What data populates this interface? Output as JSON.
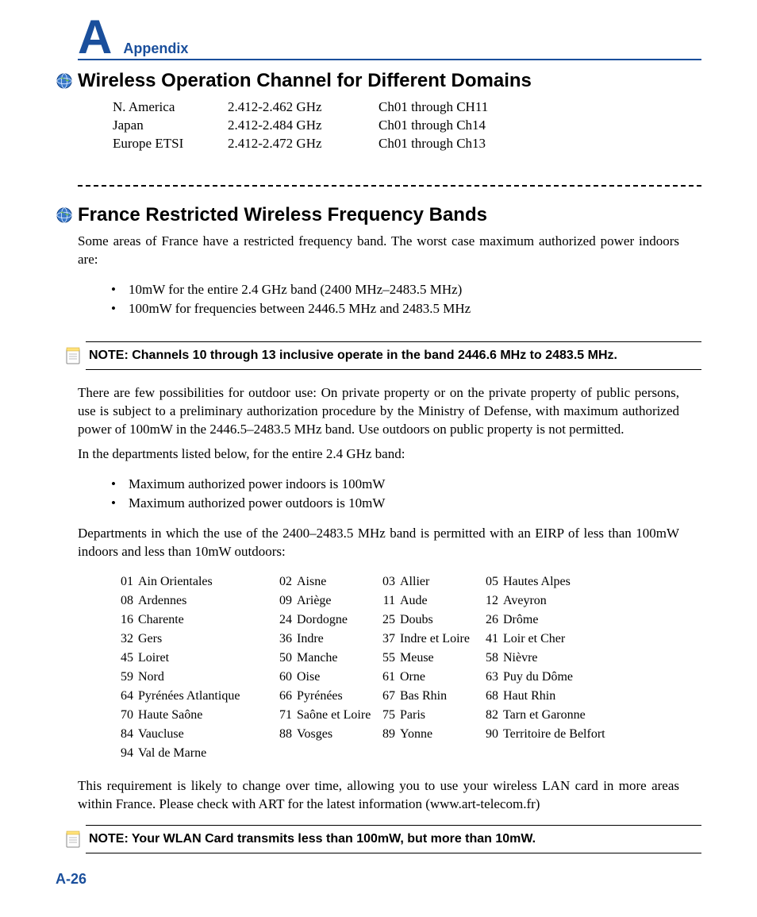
{
  "header": {
    "letter": "A",
    "label": "Appendix"
  },
  "section1": {
    "title": "Wireless Operation Channel for Different Domains",
    "rows": [
      {
        "region": "N. America",
        "freq": "2.412-2.462 GHz",
        "ch": "Ch01 through CH11"
      },
      {
        "region": "Japan",
        "freq": "2.412-2.484 GHz",
        "ch": "Ch01 through Ch14"
      },
      {
        "region": "Europe ETSI",
        "freq": "2.412-2.472 GHz",
        "ch": "Ch01 through Ch13"
      }
    ]
  },
  "section2": {
    "title": "France Restricted Wireless Frequency Bands",
    "intro": "Some areas of France have a restricted frequency band. The worst case maximum authorized power indoors are:",
    "bullets1": [
      "10mW for the entire 2.4 GHz band (2400 MHz–2483.5 MHz)",
      "100mW for frequencies between 2446.5 MHz and 2483.5 MHz"
    ],
    "note1": "NOTE: Channels 10 through 13 inclusive operate in the band 2446.6 MHz to 2483.5 MHz.",
    "para2": "There are few possibilities for outdoor use: On private property or on the private property of public persons, use is subject to a preliminary authorization procedure by the Ministry of Defense, with maximum authorized power of 100mW in the 2446.5–2483.5 MHz band. Use outdoors on public property is not permitted.",
    "para3": "In the departments listed below, for the entire 2.4 GHz band:",
    "bullets2": [
      "Maximum authorized power indoors is 100mW",
      "Maximum authorized power outdoors is 10mW"
    ],
    "para4": "Departments in which the use of the 2400–2483.5 MHz band is permitted with an EIRP of less than 100mW indoors and less than 10mW outdoors:",
    "departments": [
      [
        {
          "n": "01",
          "name": "Ain Orientales"
        },
        {
          "n": "02",
          "name": "Aisne"
        },
        {
          "n": "03",
          "name": "Allier"
        },
        {
          "n": "05",
          "name": "Hautes Alpes"
        }
      ],
      [
        {
          "n": "08",
          "name": "Ardennes"
        },
        {
          "n": "09",
          "name": "Ariège"
        },
        {
          "n": "11",
          "name": "Aude"
        },
        {
          "n": "12",
          "name": "Aveyron"
        }
      ],
      [
        {
          "n": "16",
          "name": "Charente"
        },
        {
          "n": "24",
          "name": "Dordogne"
        },
        {
          "n": "25",
          "name": "Doubs"
        },
        {
          "n": "26",
          "name": "Drôme"
        }
      ],
      [
        {
          "n": "32",
          "name": "Gers"
        },
        {
          "n": "36",
          "name": "Indre"
        },
        {
          "n": "37",
          "name": "Indre et Loire"
        },
        {
          "n": "41",
          "name": "Loir et Cher"
        }
      ],
      [
        {
          "n": "45",
          "name": "Loiret"
        },
        {
          "n": "50",
          "name": "Manche"
        },
        {
          "n": "55",
          "name": "Meuse"
        },
        {
          "n": "58",
          "name": "Nièvre"
        }
      ],
      [
        {
          "n": "59",
          "name": "Nord"
        },
        {
          "n": "60",
          "name": "Oise"
        },
        {
          "n": "61",
          "name": "Orne"
        },
        {
          "n": "63",
          "name": "Puy du Dôme"
        }
      ],
      [
        {
          "n": "64",
          "name": "Pyrénées Atlantique"
        },
        {
          "n": "66",
          "name": "Pyrénées"
        },
        {
          "n": "67",
          "name": "Bas Rhin"
        },
        {
          "n": "68",
          "name": "Haut Rhin"
        }
      ],
      [
        {
          "n": "70",
          "name": "Haute Saône"
        },
        {
          "n": "71",
          "name": "Saône et Loire"
        },
        {
          "n": "75",
          "name": "Paris"
        },
        {
          "n": "82",
          "name": "Tarn et Garonne"
        }
      ],
      [
        {
          "n": "84",
          "name": "Vaucluse"
        },
        {
          "n": "88",
          "name": "Vosges"
        },
        {
          "n": "89",
          "name": "Yonne"
        },
        {
          "n": "90",
          "name": "Territoire de Belfort"
        }
      ],
      [
        {
          "n": "94",
          "name": "Val de Marne"
        },
        null,
        null,
        null
      ]
    ],
    "para5": "This requirement is likely to change over time, allowing you to use your wireless LAN card in more areas within France. Please check with ART for the latest information (www.art-telecom.fr)",
    "note2": "NOTE: Your WLAN Card transmits less than 100mW, but more than 10mW."
  },
  "page_number": "A-26"
}
